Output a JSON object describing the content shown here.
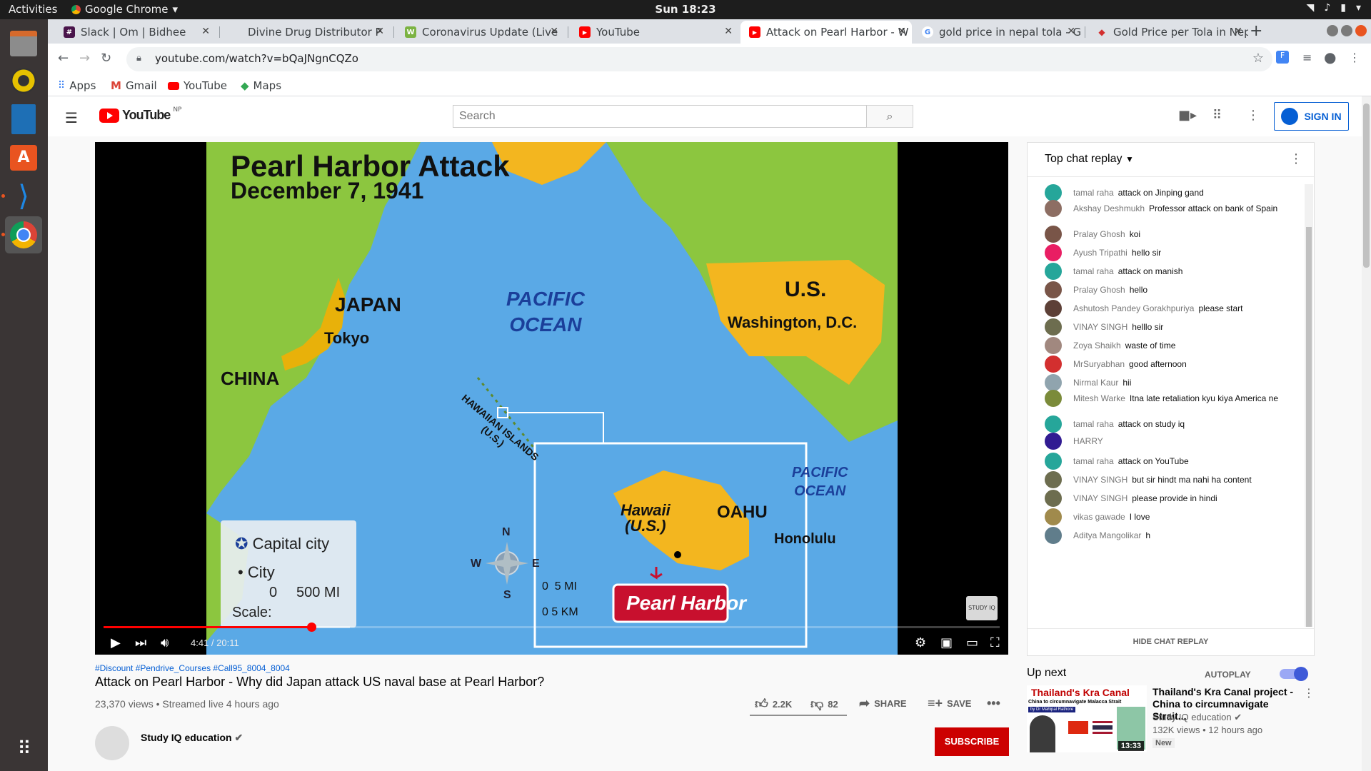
{
  "os": {
    "activities": "Activities",
    "app_name": "Google Chrome",
    "clock": "Sun 18:23"
  },
  "tabs": [
    {
      "label": "Slack | Om | Bidhee",
      "favicon_color": "#4a154b",
      "favicon": "#"
    },
    {
      "label": "Divine Drug Distributor P",
      "favicon_color": "#dee1e6",
      "favicon": ""
    },
    {
      "label": "Coronavirus Update (Live",
      "favicon_color": "#7cb342",
      "favicon": "W"
    },
    {
      "label": "YouTube",
      "favicon_color": "#ff0000",
      "favicon": "▶"
    },
    {
      "label": "Attack on Pearl Harbor - W",
      "favicon_color": "#ff0000",
      "favicon": "▶"
    },
    {
      "label": "gold price in nepal tola - G",
      "favicon_color": "#4285f4",
      "favicon": "G"
    },
    {
      "label": "Gold Price per Tola in Nep",
      "favicon_color": "#d32f2f",
      "favicon": "◆"
    }
  ],
  "omnibox": {
    "url": "youtube.com/watch?v=bQaJNgnCQZo"
  },
  "bookmarks": [
    {
      "label": "Apps",
      "icon": "apps-grid-icon"
    },
    {
      "label": "Gmail",
      "icon": "gmail-icon"
    },
    {
      "label": "YouTube",
      "icon": "youtube-icon"
    },
    {
      "label": "Maps",
      "icon": "maps-icon"
    }
  ],
  "youtube": {
    "logo_text": "YouTube",
    "country_code": "NP",
    "search_placeholder": "Search",
    "sign_in": "SIGN IN"
  },
  "video_frame": {
    "title_line1": "Pearl Harbor Attack",
    "title_line2": "December 7, 1941",
    "japan": "JAPAN",
    "tokyo": "Tokyo",
    "china": "CHINA",
    "pacific_ocean": "PACIFIC\nOCEAN",
    "us": "U.S.",
    "washington": "Washington, D.C.",
    "hawaiian_islands": "HAWAIIAN ISLANDS\n(U.S.)",
    "hawaii": "Hawaii\n(U.S.)",
    "oahu": "OAHU",
    "honolulu": "Honolulu",
    "inset_pacific": "PACIFIC\nOCEAN",
    "pearl_harbor": "Pearl Harbor",
    "legend_capital": "Capital city",
    "legend_city": "City",
    "scale_label": "Scale:",
    "scale_zero": "0",
    "scale_500": "500 MI",
    "inset_scale_mi": "0  5 MI",
    "inset_scale_km": "0 5 KM",
    "compass_n": "N",
    "compass_s": "S",
    "compass_e": "E",
    "compass_w": "W",
    "watermark": "STUDY IQ"
  },
  "player": {
    "time": "4:41 / 20:11",
    "played_fraction": 0.232,
    "buffered_fraction": 0.275
  },
  "video": {
    "hashtags": "#Discount #Pendrive_Courses #Call95_8004_8004",
    "title": "Attack on Pearl Harbor - Why did Japan attack US naval base at Pearl Harbor?",
    "meta": "23,370 views • Streamed live 4 hours ago",
    "likes": "2.2K",
    "dislikes": "82",
    "share": "SHARE",
    "save": "SAVE",
    "channel": "Study IQ education",
    "subscribe": "SUBSCRIBE"
  },
  "chat": {
    "header": "Top chat replay",
    "hide": "HIDE CHAT REPLAY",
    "messages": [
      {
        "author": "tamal raha",
        "text": "attack on Jinping gand",
        "color": "#26a69a"
      },
      {
        "author": "Akshay Deshmukh",
        "text": "Professor attack on bank of Spain",
        "color": "#8d6e63"
      },
      {
        "author": "Pralay Ghosh",
        "text": "koi",
        "color": "#795548"
      },
      {
        "author": "Ayush Tripathi",
        "text": "hello sir",
        "color": "#e91e63"
      },
      {
        "author": "tamal raha",
        "text": "attack on manish",
        "color": "#26a69a"
      },
      {
        "author": "Pralay Ghosh",
        "text": "hello",
        "color": "#795548"
      },
      {
        "author": "Ashutosh Pandey Gorakhpuriya",
        "text": "please start",
        "color": "#5d4037"
      },
      {
        "author": "VINAY SINGH",
        "text": "helllo sir",
        "color": "#6d6d4f"
      },
      {
        "author": "Zoya Shaikh",
        "text": "waste of time",
        "color": "#a1887f"
      },
      {
        "author": "MrSuryabhan",
        "text": "good afternoon",
        "color": "#d32f2f"
      },
      {
        "author": "Nirmal Kaur",
        "text": "hii",
        "color": "#90a4ae"
      },
      {
        "author": "Mitesh Warke",
        "text": "Itna late retaliation kyu kiya America ne",
        "color": "#7b8b3a"
      },
      {
        "author": "tamal raha",
        "text": "attack on study iq",
        "color": "#26a69a"
      },
      {
        "author": "HARRY",
        "text": "",
        "color": "#311b92"
      },
      {
        "author": "tamal raha",
        "text": "attack on YouTube",
        "color": "#26a69a"
      },
      {
        "author": "VINAY SINGH",
        "text": "but sir hindt ma nahi ha content",
        "color": "#6d6d4f"
      },
      {
        "author": "VINAY SINGH",
        "text": "please provide in hindi",
        "color": "#6d6d4f"
      },
      {
        "author": "vikas gawade",
        "text": "I love",
        "color": "#a08a4c"
      },
      {
        "author": "Aditya Mangolikar",
        "text": "h",
        "color": "#607d8b"
      }
    ]
  },
  "upnext": {
    "label": "Up next",
    "autoplay": "AUTOPLAY",
    "thumb_title": "Thailand's Kra Canal",
    "thumb_sub": "China to circumnavigate Malacca Strait",
    "thumb_by": "by Dr Mahipal Rathore",
    "duration": "13:33",
    "title": "Thailand's Kra Canal project - China to circumnavigate Strait...",
    "channel": "Study IQ education",
    "meta": "132K views • 12 hours ago",
    "badge": "New"
  }
}
